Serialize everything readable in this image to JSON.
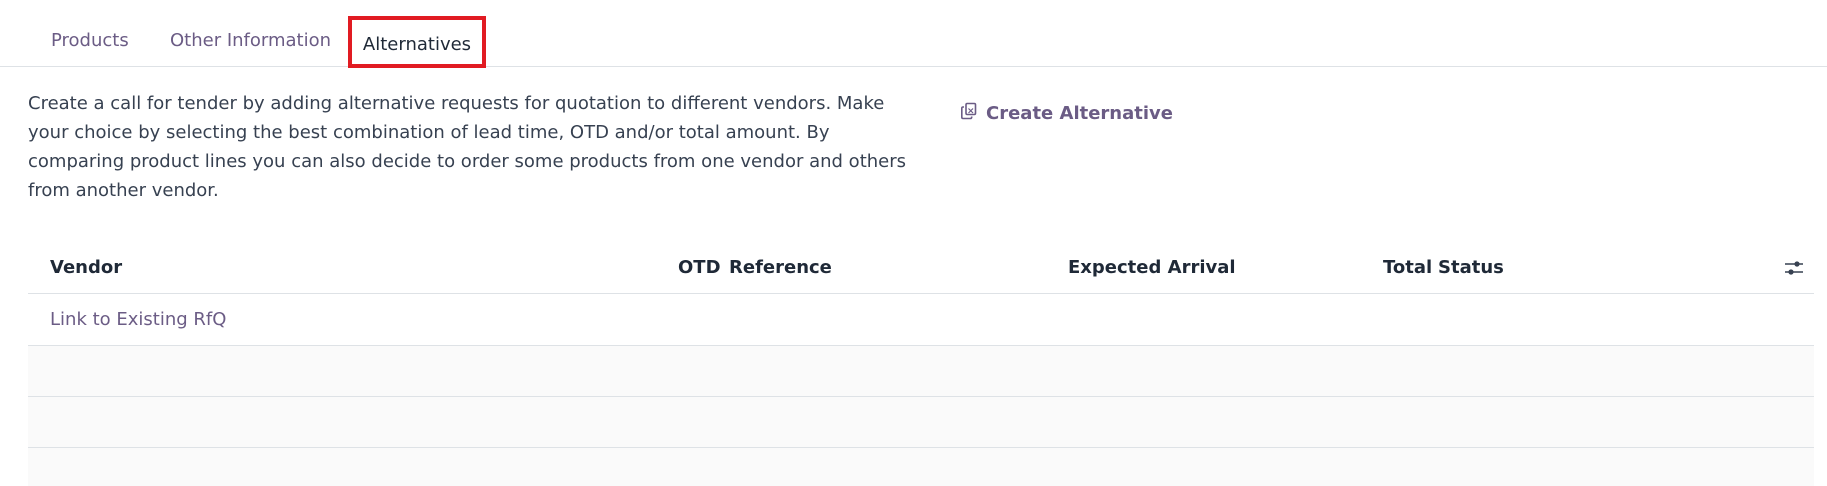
{
  "tabs": [
    {
      "label": "Products"
    },
    {
      "label": "Other Information"
    },
    {
      "label": "Alternatives",
      "active": true,
      "highlight_color": "#e11b22"
    }
  ],
  "alternatives": {
    "description": "Create a call for tender by adding alternative requests for quotation to different vendors. Make your choice by selecting the best combination of lead time, OTD and/or total amount. By comparing product lines you can also decide to order some products from one vendor and others from another vendor.",
    "create_button": "Create Alternative",
    "create_icon": "copy-icon"
  },
  "table": {
    "columns": {
      "vendor": "Vendor",
      "otd": "OTD",
      "reference": "Reference",
      "expected_arrival": "Expected Arrival",
      "total": "Total",
      "status": "Status"
    },
    "settings_icon": "sliders-icon",
    "link_existing": "Link to Existing RfQ"
  },
  "colors": {
    "accent": "#6b5c85",
    "text": "#374151",
    "heading": "#1f2937",
    "border": "#dee2e6"
  }
}
